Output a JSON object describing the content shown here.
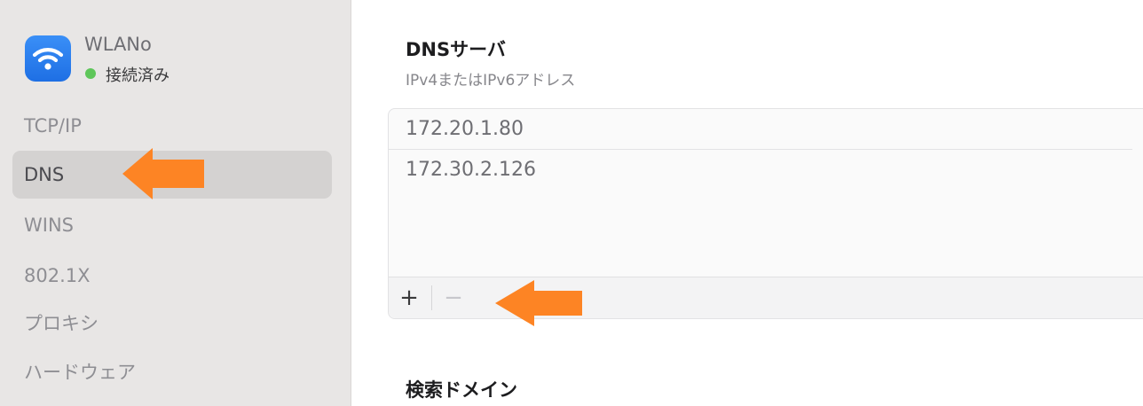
{
  "sidebar": {
    "network": {
      "name": "WLANo",
      "status": "接続済み",
      "icon": "wifi-icon",
      "status_color": "#5ec65a"
    },
    "items": [
      {
        "label": "TCP/IP"
      },
      {
        "label": "DNS",
        "selected": true
      },
      {
        "label": "WINS"
      },
      {
        "label": "802.1X"
      },
      {
        "label": "プロキシ"
      },
      {
        "label": "ハードウェア"
      }
    ]
  },
  "main": {
    "dns": {
      "title": "DNSサーバ",
      "subtitle": "IPv4またはIPv6アドレス",
      "servers": [
        "172.20.1.80",
        "172.30.2.126"
      ],
      "add_label": "+",
      "remove_label": "−"
    },
    "search_domains": {
      "title": "検索ドメイン"
    }
  },
  "annotations": {
    "arrow_color": "#fd8424"
  }
}
